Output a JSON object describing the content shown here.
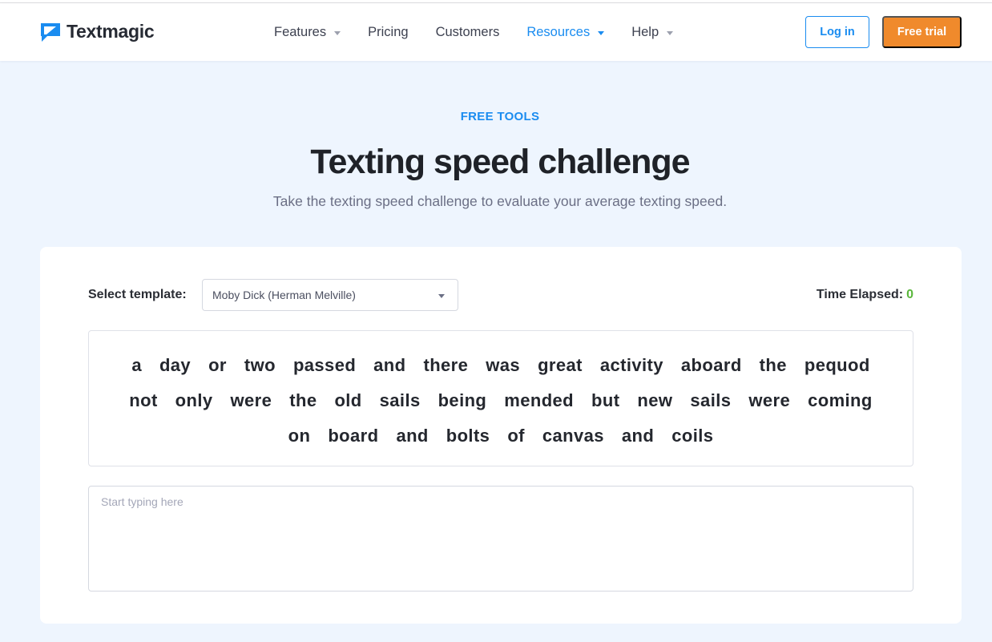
{
  "header": {
    "logo_text": "Textmagic",
    "nav": [
      {
        "label": "Features",
        "dropdown": true,
        "active": false
      },
      {
        "label": "Pricing",
        "dropdown": false,
        "active": false
      },
      {
        "label": "Customers",
        "dropdown": false,
        "active": false
      },
      {
        "label": "Resources",
        "dropdown": true,
        "active": true
      },
      {
        "label": "Help",
        "dropdown": true,
        "active": false
      }
    ],
    "login_label": "Log in",
    "trial_label": "Free trial"
  },
  "hero": {
    "eyebrow": "FREE TOOLS",
    "title": "Texting speed challenge",
    "subtitle": "Take the texting speed challenge to evaluate your average texting speed."
  },
  "challenge": {
    "select_label": "Select template:",
    "selected_template": "Moby Dick (Herman Melville)",
    "time_label": "Time Elapsed:",
    "time_value": "0",
    "words": [
      "a",
      "day",
      "or",
      "two",
      "passed",
      "and",
      "there",
      "was",
      "great",
      "activity",
      "aboard",
      "the",
      "pequod",
      "not",
      "only",
      "were",
      "the",
      "old",
      "sails",
      "being",
      "mended",
      "but",
      "new",
      "sails",
      "were",
      "coming",
      "on",
      "board",
      "and",
      "bolts",
      "of",
      "canvas",
      "and",
      "coils"
    ],
    "input_placeholder": "Start typing here",
    "input_value": ""
  },
  "colors": {
    "accent": "#1a8cf0",
    "cta": "#f08a2c",
    "timer": "#5ab73c",
    "background": "#eef5fe"
  }
}
